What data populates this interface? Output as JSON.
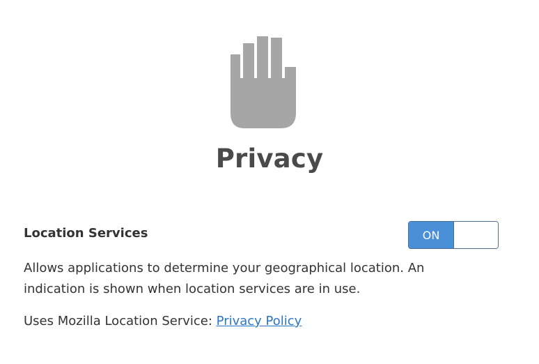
{
  "header": {
    "icon": "hand-icon",
    "title": "Privacy"
  },
  "location_services": {
    "label": "Location Services",
    "toggle_state": "ON",
    "description": "Allows applications to determine your geographical location. An indication is shown when location services are in use.",
    "service_prefix": "Uses Mozilla Location Service:",
    "privacy_link": "Privacy Policy"
  },
  "colors": {
    "icon": "#a6a6a6",
    "toggle_on": "#4a90d9",
    "link": "#2a76c6"
  }
}
